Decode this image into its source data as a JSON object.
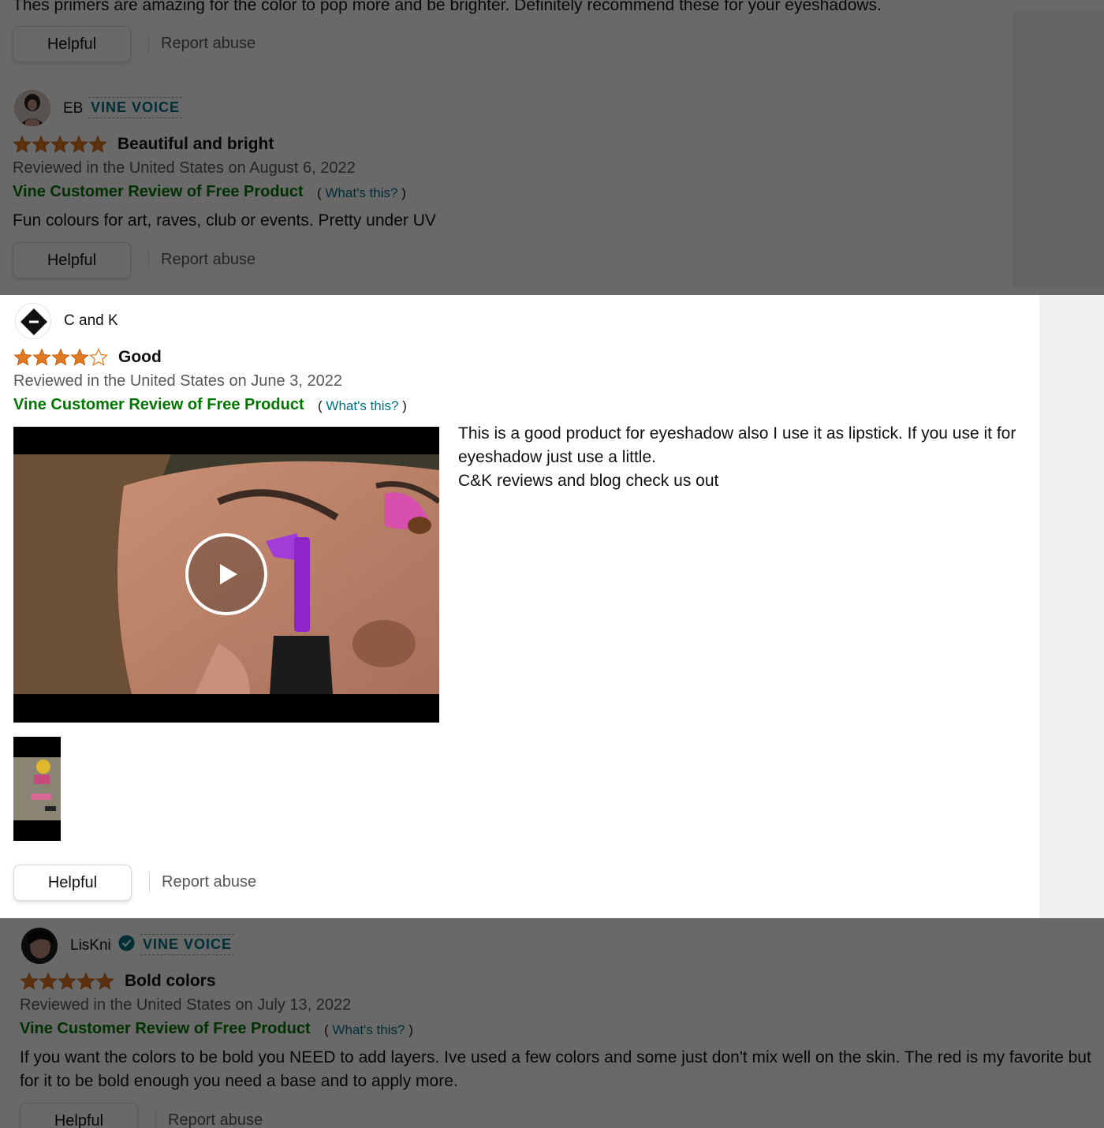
{
  "colors": {
    "link": "#007185",
    "vine_green": "#007600",
    "star_orange": "#de7921",
    "secondary_text": "#565959"
  },
  "reviews": [
    {
      "text_partial": "Thes primers are amazing for the color to pop more and be brighter. Definitely recommend these for your eyeshadows.",
      "helpful_label": "Helpful",
      "report_label": "Report abuse"
    },
    {
      "profile_name": "EB",
      "badge": "VINE VOICE",
      "rating": 5,
      "title": "Beautiful and bright",
      "date": "Reviewed in the United States on August 6, 2022",
      "vine_label": "Vine Customer Review of Free Product",
      "whats_open": "(",
      "whats_link": "What's this?",
      "whats_close": ")",
      "text": "Fun colours for art, raves, club or events. Pretty under UV",
      "helpful_label": "Helpful",
      "report_label": "Report abuse"
    },
    {
      "profile_name": "C and K",
      "rating": 4,
      "title": "Good",
      "date": "Reviewed in the United States on June 3, 2022",
      "vine_label": "Vine Customer Review of Free Product",
      "whats_open": "(",
      "whats_link": "What's this?",
      "whats_close": ")",
      "text_line1": " This is a good product for eyeshadow also I use it as lipstick. If you use it for eyeshadow just use a little.",
      "text_line2": "C&K reviews and blog check us out",
      "helpful_label": "Helpful",
      "report_label": "Report abuse",
      "media_icon": "play-icon"
    },
    {
      "profile_name": "LisKni",
      "verified_icon": "verified-check-icon",
      "badge": "VINE VOICE",
      "rating": 5,
      "title": "Bold colors",
      "date": "Reviewed in the United States on July 13, 2022",
      "vine_label": "Vine Customer Review of Free Product",
      "whats_open": "(",
      "whats_link": "What's this?",
      "whats_close": ")",
      "text": "If you want the colors to be bold you NEED to add layers. Ive used a few colors and some just don't mix well on the skin. The red is my favorite but for it to be bold enough you need a base and to apply more.",
      "helpful_label": "Helpful",
      "report_label": "Report abuse"
    }
  ]
}
